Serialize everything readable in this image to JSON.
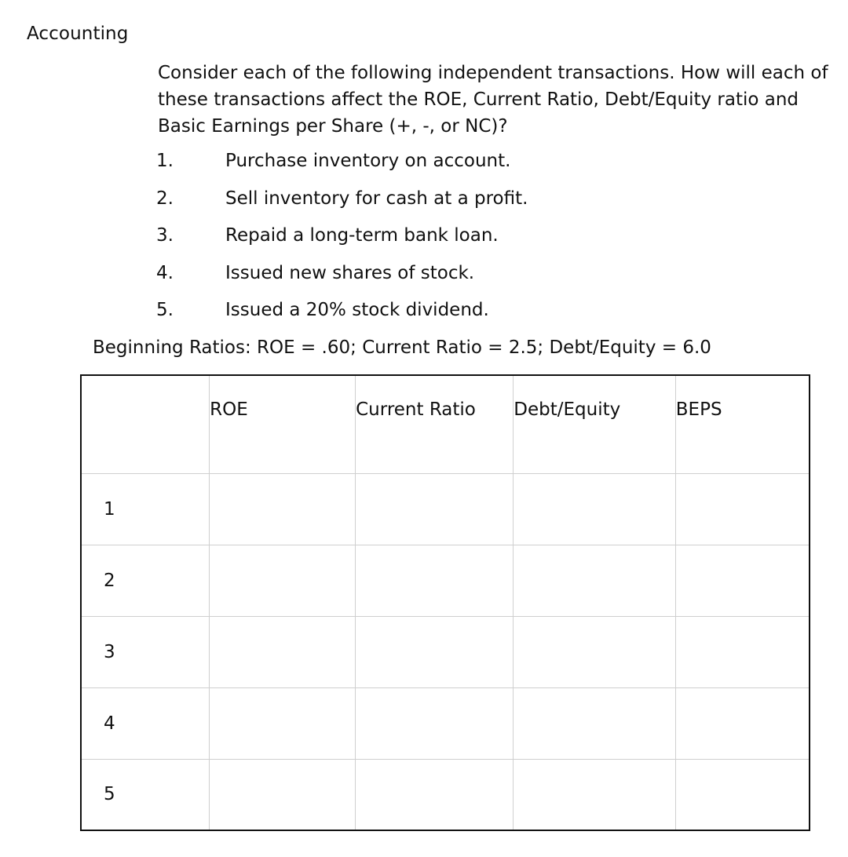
{
  "subject": "Accounting",
  "question": {
    "prompt": "Consider each of the following independent transactions. How will each of these transactions affect the ROE, Current Ratio, Debt/Equity ratio and Basic Earnings per Share (+, -, or NC)?",
    "transactions": [
      {
        "number": "1.",
        "text": "Purchase inventory on account."
      },
      {
        "number": "2.",
        "text": "Sell inventory for cash at a profit."
      },
      {
        "number": "3.",
        "text": "Repaid a long-term bank loan."
      },
      {
        "number": "4.",
        "text": "Issued new shares of stock."
      },
      {
        "number": "5.",
        "text": "Issued a 20% stock dividend."
      }
    ],
    "beginning_ratios": "Beginning Ratios: ROE = .60; Current Ratio = 2.5; Debt/Equity = 6.0"
  },
  "table": {
    "headers": [
      "",
      "ROE",
      "Current Ratio",
      "Debt/Equity",
      "BEPS"
    ],
    "rows": [
      {
        "label": "1",
        "cells": [
          "",
          "",
          "",
          ""
        ]
      },
      {
        "label": "2",
        "cells": [
          "",
          "",
          "",
          ""
        ]
      },
      {
        "label": "3",
        "cells": [
          "",
          "",
          "",
          ""
        ]
      },
      {
        "label": "4",
        "cells": [
          "",
          "",
          "",
          ""
        ]
      },
      {
        "label": "5",
        "cells": [
          "",
          "",
          "",
          ""
        ]
      }
    ]
  }
}
